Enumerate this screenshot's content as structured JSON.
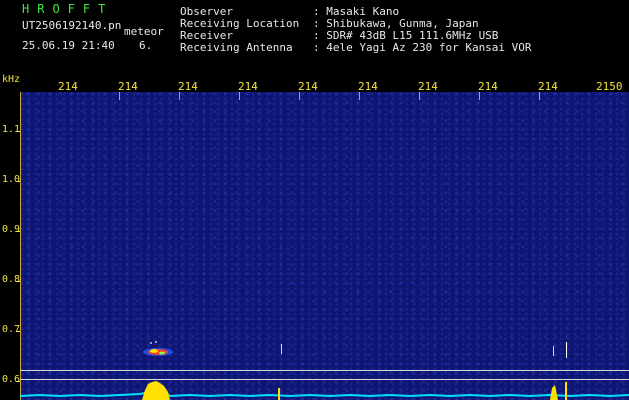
{
  "header": {
    "logo": "HROFFT",
    "filename": "UT2506192140.pn",
    "tag": "meteor",
    "datetime": "25.06.19 21:40",
    "count": "6.",
    "labels": [
      "Observer",
      "Receiving Location",
      "Receiver",
      "Receiving Antenna"
    ],
    "values": [
      ": Masaki Kano",
      ": Shibukawa, Gunma, Japan",
      ": SDR# 43dB L15 111.6MHz USB",
      ": 4ele Yagi Az 230 for Kansai VOR"
    ]
  },
  "axes": {
    "y_unit": "kHz",
    "y_ticks": [
      "1.1",
      "1.0",
      "0.9",
      "0.8",
      "0.7",
      "0.6"
    ],
    "x_ticks": [
      "214",
      "214",
      "214",
      "214",
      "214",
      "214",
      "214",
      "214",
      "214",
      "2150"
    ]
  },
  "colors": {
    "background": "#000000",
    "plot": "#0e1672",
    "axis_text": "#f2e23a",
    "logo": "#3ee83e",
    "spectrum": "#00e0ff",
    "signal": "#ffe000"
  }
}
